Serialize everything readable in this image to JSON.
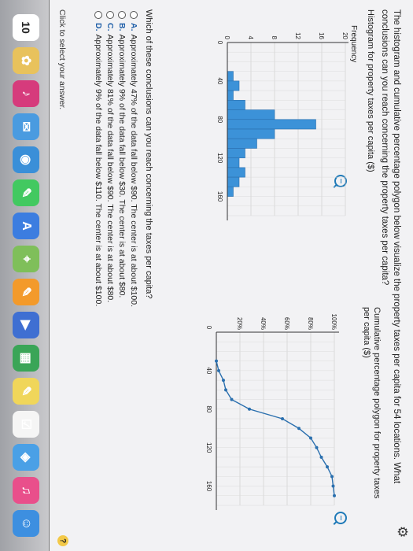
{
  "question": "The histogram and cumulative percentage polygon below visualize the property taxes per capita for 54 locations. What conclusions can you reach concerning the property taxes per capita?",
  "histogram": {
    "title": "Histogram for property taxes per capita ($)",
    "ylabel": "Frequency"
  },
  "polygon": {
    "title": "Cumulative percentage polygon for property taxes per capita ($)"
  },
  "prompt": "Which of these conclusions can you reach concerning the taxes per capita?",
  "choices": [
    {
      "letter": "A.",
      "text": "Approximately 47% of the data fall below $90. The center is at about $100."
    },
    {
      "letter": "B.",
      "text": "Approximately 9% of the data fall below $30. The center is at about $80."
    },
    {
      "letter": "C.",
      "text": "Approximately 81% of the data fall below $90. The center is at about $80."
    },
    {
      "letter": "D.",
      "text": "Approximately 9% of the data fall below $110. The center is at about $100."
    }
  ],
  "hint": "Click to select your answer.",
  "help": "?",
  "dock": {
    "calendar_day": "10",
    "icons": [
      "calendar-icon",
      "photos-icon",
      "itunes-icon",
      "mail-icon",
      "safari-icon",
      "messages-icon",
      "app-store-icon",
      "maps-icon",
      "pages-icon",
      "keynote-icon",
      "numbers-icon",
      "notes-icon",
      "reminders-icon",
      "preview-icon",
      "music-icon",
      "finder-icon"
    ],
    "icon_colors": [
      "#ffffff",
      "#e8c25c",
      "#d63b7c",
      "#4a9be0",
      "#3a8fd8",
      "#42c960",
      "#3c7de0",
      "#7fbf5a",
      "#f39a2b",
      "#3f6fd2",
      "#3aa557",
      "#f0d65a",
      "#f5f5f5",
      "#4aa0e6",
      "#e94f8b",
      "#3d8fe0"
    ],
    "icon_glyphs": [
      "",
      "✿",
      "♪",
      "✉",
      "◉",
      "✎",
      "A",
      "⌖",
      "✎",
      "▶",
      "▦",
      "✎",
      "☑",
      "◈",
      "♫",
      "☺"
    ]
  },
  "chart_data": [
    {
      "type": "bar",
      "title": "Histogram for property taxes per capita ($)",
      "ylabel": "Frequency",
      "xlabel": "",
      "x_ticks": [
        0,
        40,
        80,
        120,
        160
      ],
      "y_ticks": [
        0,
        4,
        8,
        12,
        16,
        20
      ],
      "ylim": [
        0,
        20
      ],
      "xlim": [
        0,
        180
      ],
      "bin_width": 10,
      "categories": [
        10,
        20,
        30,
        40,
        50,
        60,
        70,
        80,
        90,
        100,
        110,
        120,
        130,
        140,
        150,
        160
      ],
      "values": [
        0,
        0,
        0,
        1,
        2,
        1,
        3,
        8,
        15,
        8,
        5,
        3,
        2,
        3,
        2,
        1
      ],
      "grid": true
    },
    {
      "type": "line",
      "title": "Cumulative percentage polygon for property taxes per capita ($)",
      "xlabel": "",
      "ylabel": "",
      "x_ticks": [
        0,
        40,
        80,
        120,
        160
      ],
      "y_ticks": [
        "20%",
        "40%",
        "60%",
        "80%",
        "100%"
      ],
      "ylim": [
        0,
        100
      ],
      "xlim": [
        0,
        180
      ],
      "x": [
        30,
        40,
        50,
        60,
        70,
        80,
        90,
        100,
        110,
        120,
        130,
        140,
        150,
        160,
        170
      ],
      "values": [
        0,
        2,
        6,
        8,
        13,
        28,
        56,
        70,
        80,
        85,
        89,
        94,
        98,
        99,
        100
      ],
      "grid": true
    }
  ]
}
